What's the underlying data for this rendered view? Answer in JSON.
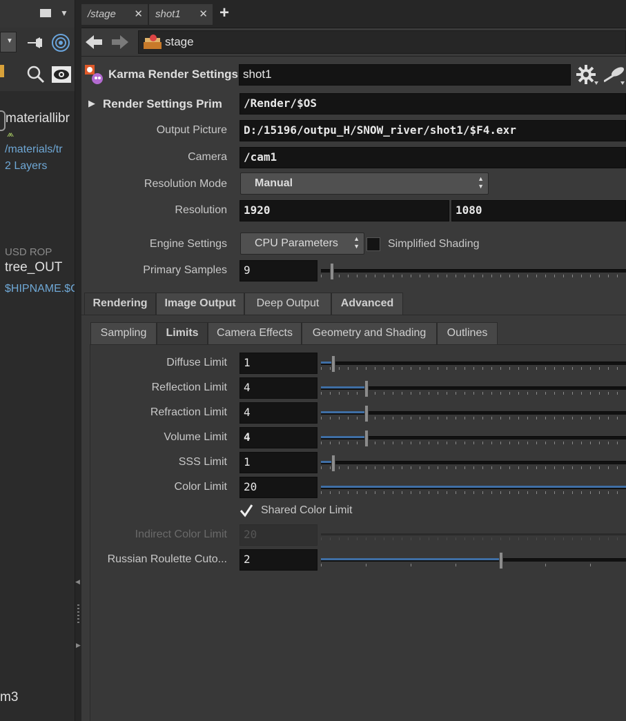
{
  "left": {
    "node1_name": "materiallibr",
    "node1_path": "/materials/tr",
    "node1_layers": "2 Layers",
    "node2_type": "USD ROP",
    "node2_name": "tree_OUT",
    "node2_path": "$HIPNAME.$C",
    "bottom_text": "m3"
  },
  "tabs": [
    {
      "label": "/stage"
    },
    {
      "label": "shot1"
    }
  ],
  "path": {
    "label": "stage"
  },
  "node": {
    "type_label": "Karma Render Settings",
    "name": "shot1"
  },
  "folder": {
    "label": "Render Settings Prim",
    "value": "/Render/$OS"
  },
  "fields": {
    "output_label": "Output Picture",
    "output_value": "D:/15196/outpu_H/SNOW_river/shot1/$F4.exr",
    "camera_label": "Camera",
    "camera_value": "/cam1",
    "resmode_label": "Resolution Mode",
    "resmode_value": "Manual",
    "resolution_label": "Resolution",
    "res_x": "1920",
    "res_y": "1080",
    "engine_label": "Engine Settings",
    "engine_value": "CPU Parameters",
    "simplified_label": "Simplified Shading",
    "primary_label": "Primary Samples",
    "primary_value": "9"
  },
  "main_tabs": [
    "Rendering",
    "Image Output",
    "Deep Output",
    "Advanced"
  ],
  "sub_tabs": [
    "Sampling",
    "Limits",
    "Camera Effects",
    "Geometry and Shading",
    "Outlines"
  ],
  "limits": [
    {
      "label": "Diffuse Limit",
      "value": "1",
      "fraction": 0.04
    },
    {
      "label": "Reflection Limit",
      "value": "4",
      "fraction": 0.15
    },
    {
      "label": "Refraction Limit",
      "value": "4",
      "fraction": 0.15
    },
    {
      "label": "Volume Limit",
      "value": "4",
      "fraction": 0.15
    },
    {
      "label": "SSS Limit",
      "value": "1",
      "fraction": 0.04
    },
    {
      "label": "Color Limit",
      "value": "20",
      "fraction": 1.0
    }
  ],
  "shared_color": {
    "label": "Shared Color Limit",
    "checked": true
  },
  "indirect": {
    "label": "Indirect Color Limit",
    "value": "20"
  },
  "roulette": {
    "label": "Russian Roulette Cuto...",
    "value": "2",
    "fraction": 0.59
  },
  "colors": {
    "accent": "#3f6fa6",
    "link": "#6fa8d6"
  }
}
